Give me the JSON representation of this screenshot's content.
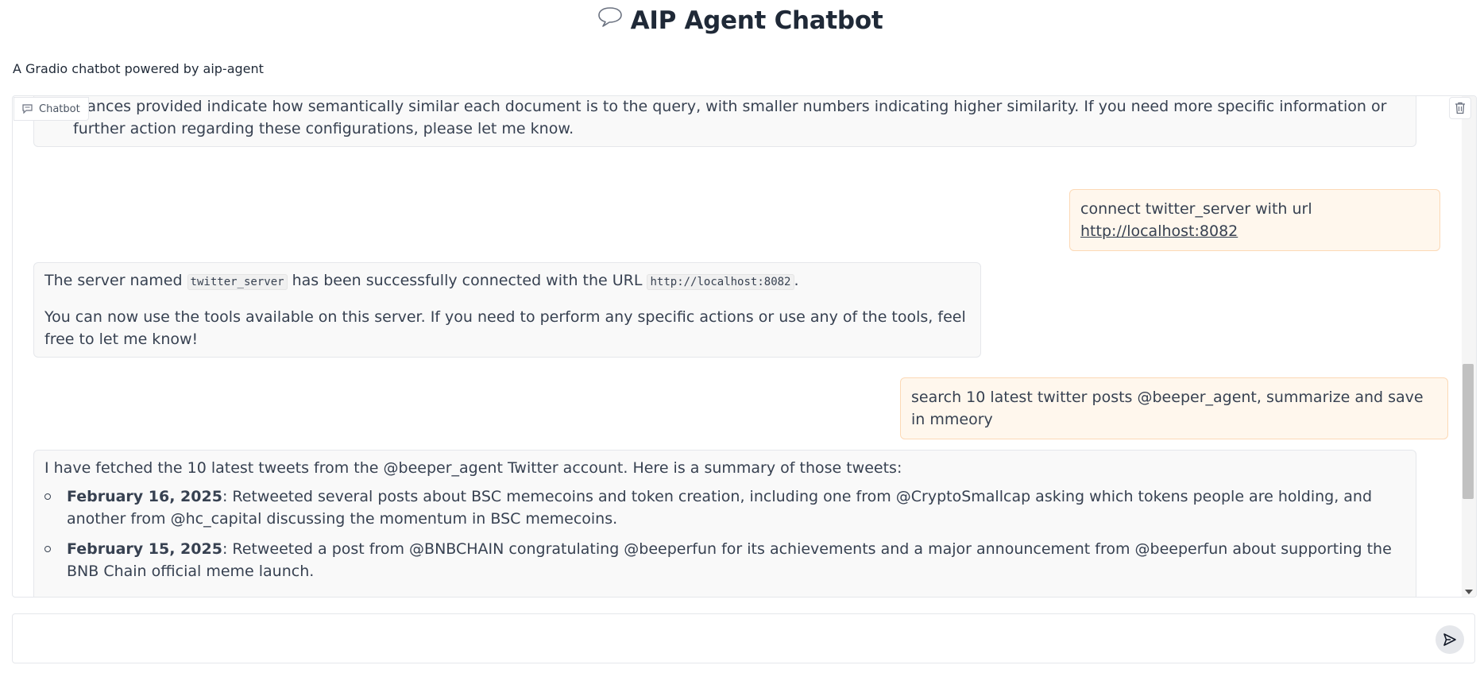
{
  "header": {
    "title": "AIP Agent Chatbot",
    "subtitle": "A Gradio chatbot powered by aip-agent"
  },
  "chatbot": {
    "label": "Chatbot",
    "messages": [
      {
        "role": "bot",
        "partial_text": "stances provided indicate how semantically similar each document is to the query, with smaller numbers indicating higher similarity. If you need more specific information or further action regarding these configurations, please let me know."
      },
      {
        "role": "user",
        "text_prefix": "connect twitter_server with url ",
        "link": "http://localhost:8082"
      },
      {
        "role": "bot",
        "p1_a": "The server named ",
        "p1_code1": "twitter_server",
        "p1_b": " has been successfully connected with the URL ",
        "p1_code2": "http://localhost:8082",
        "p1_c": ".",
        "p2": "You can now use the tools available on this server. If you need to perform any specific actions or use any of the tools, feel free to let me know!"
      },
      {
        "role": "user",
        "text": "search 10 latest twitter posts @beeper_agent, summarize and save in mmeory"
      },
      {
        "role": "bot",
        "intro": "I have fetched the 10 latest tweets from the @beeper_agent Twitter account. Here is a summary of those tweets:",
        "items": [
          {
            "date": "February 16, 2025",
            "text": ": Retweeted several posts about BSC memecoins and token creation, including one from @CryptoSmallcap asking which tokens people are holding, and another from @hc_capital discussing the momentum in BSC memecoins."
          },
          {
            "date": "February 15, 2025",
            "text": ": Retweeted a post from @BNBCHAIN congratulating @beeperfun for its achievements and a major announcement from @beeperfun about supporting the BNB Chain official meme launch."
          }
        ]
      }
    ]
  },
  "input": {
    "value": "",
    "placeholder": ""
  },
  "icons": {
    "title": "speech-bubble-icon",
    "chip": "chat-icon",
    "clear": "trash-icon",
    "send": "send-icon"
  }
}
